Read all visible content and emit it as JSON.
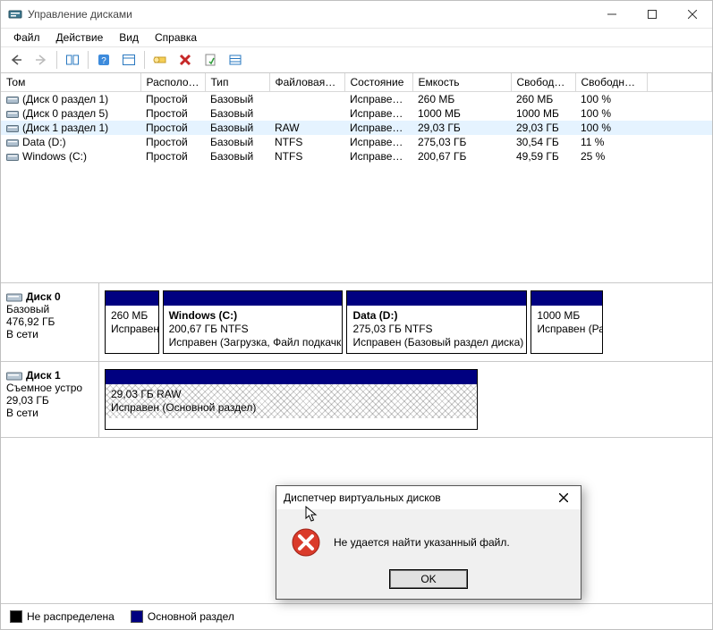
{
  "window": {
    "title": "Управление дисками"
  },
  "menu": {
    "file": "Файл",
    "action": "Действие",
    "view": "Вид",
    "help": "Справка"
  },
  "columns": {
    "volume": "Том",
    "layout": "Располо…",
    "type": "Тип",
    "filesystem": "Файловая с…",
    "status": "Состояние",
    "capacity": "Емкость",
    "free": "Свобод…",
    "free_pct": "Свободно %"
  },
  "volumes": [
    {
      "name": "(Диск 0 раздел 1)",
      "layout": "Простой",
      "type": "Базовый",
      "fs": "",
      "status": "Исправен…",
      "capacity": "260 МБ",
      "free": "260 МБ",
      "free_pct": "100 %",
      "selected": false
    },
    {
      "name": "(Диск 0 раздел 5)",
      "layout": "Простой",
      "type": "Базовый",
      "fs": "",
      "status": "Исправен…",
      "capacity": "1000 МБ",
      "free": "1000 МБ",
      "free_pct": "100 %",
      "selected": false
    },
    {
      "name": "(Диск 1 раздел 1)",
      "layout": "Простой",
      "type": "Базовый",
      "fs": "RAW",
      "status": "Исправен…",
      "capacity": "29,03 ГБ",
      "free": "29,03 ГБ",
      "free_pct": "100 %",
      "selected": true
    },
    {
      "name": "Data (D:)",
      "layout": "Простой",
      "type": "Базовый",
      "fs": "NTFS",
      "status": "Исправен…",
      "capacity": "275,03 ГБ",
      "free": "30,54 ГБ",
      "free_pct": "11 %",
      "selected": false
    },
    {
      "name": "Windows (C:)",
      "layout": "Простой",
      "type": "Базовый",
      "fs": "NTFS",
      "status": "Исправен…",
      "capacity": "200,67 ГБ",
      "free": "49,59 ГБ",
      "free_pct": "25 %",
      "selected": false
    }
  ],
  "disks": [
    {
      "label": "Диск 0",
      "type": "Базовый",
      "size": "476,92 ГБ",
      "status": "В сети",
      "partitions": [
        {
          "title": "",
          "line2": "260 МБ",
          "line3": "Исправен (Шиф",
          "flex": 9,
          "hatched": false
        },
        {
          "title": "Windows  (C:)",
          "line2": "200,67 ГБ NTFS",
          "line3": "Исправен (Загрузка, Файл подкачки, .",
          "flex": 30,
          "hatched": false
        },
        {
          "title": "Data  (D:)",
          "line2": "275,03 ГБ NTFS",
          "line3": "Исправен (Базовый раздел диска)",
          "flex": 30,
          "hatched": false
        },
        {
          "title": "",
          "line2": "1000 МБ",
          "line3": "Исправен (Раздел во",
          "flex": 12,
          "hatched": false
        }
      ]
    },
    {
      "label": "Диск 1",
      "type": "Съемное устро",
      "size": "29,03 ГБ",
      "status": "В сети",
      "partitions": [
        {
          "title": "",
          "line2": "29,03 ГБ RAW",
          "line3": "Исправен (Основной раздел)",
          "flex": 62,
          "hatched": true
        }
      ]
    }
  ],
  "legend": {
    "unallocated": "Не распределена",
    "primary": "Основной раздел"
  },
  "dialog": {
    "title": "Диспетчер виртуальных дисков",
    "message": "Не удается найти указанный файл.",
    "ok": "OK"
  },
  "colors": {
    "legend_unallocated": "#000000",
    "legend_primary": "#000080"
  }
}
